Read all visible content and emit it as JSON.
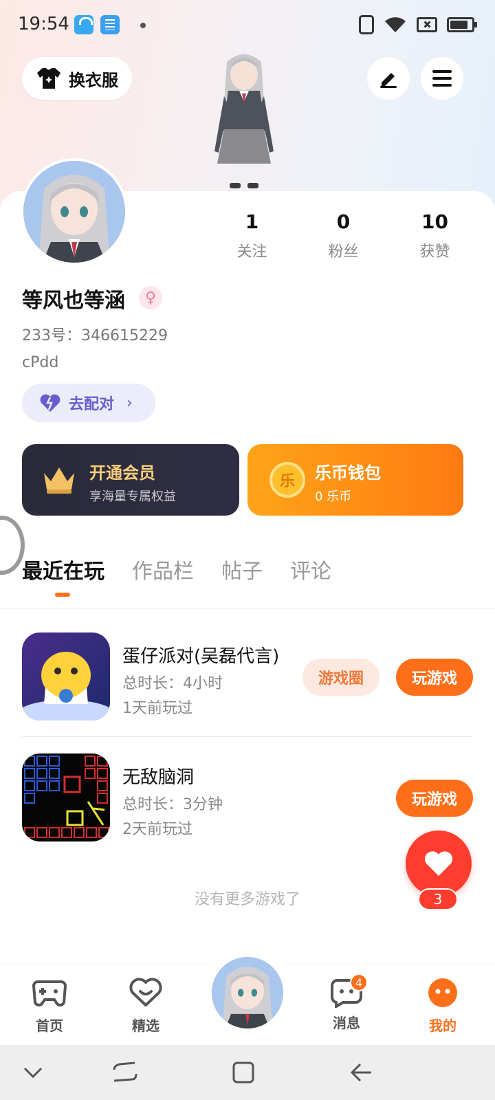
{
  "status_bar": {
    "time": "19:54",
    "battery_level": 0.85
  },
  "header": {
    "dress_label": "换衣服"
  },
  "profile": {
    "username": "等风也等涵",
    "uid": "233号：346615229",
    "signature": "cPdd",
    "match_label": "去配对",
    "stats": [
      {
        "value": "1",
        "label": "关注"
      },
      {
        "value": "0",
        "label": "粉丝"
      },
      {
        "value": "10",
        "label": "获赞"
      }
    ]
  },
  "cards": {
    "vip_title": "开通会员",
    "vip_subtitle": "享海量专属权益",
    "wallet_title": "乐币钱包",
    "wallet_subtitle": "0 乐币",
    "coin_glyph": "乐"
  },
  "tabs": [
    "最近在玩",
    "作品栏",
    "帖子",
    "评论"
  ],
  "games": [
    {
      "name": "蛋仔派对(吴磊代言)",
      "duration": "总时长：4小时",
      "last_played": "1天前玩过",
      "circle_label": "游戏圈",
      "play_label": "玩游戏"
    },
    {
      "name": "无敌脑洞",
      "duration": "总时长：3分钟",
      "last_played": "2天前玩过",
      "play_label": "玩游戏"
    }
  ],
  "no_more": "没有更多游戏了",
  "like_count": "3",
  "bottom_nav": {
    "items": [
      {
        "label": "首页",
        "icon": "gamepad-icon"
      },
      {
        "label": "精选",
        "icon": "heart-chat-icon"
      },
      {
        "label": "消息",
        "icon": "message-icon",
        "badge": "4"
      },
      {
        "label": "我的",
        "icon": "me-icon"
      }
    ]
  },
  "colors": {
    "accent": "#ff6f1a",
    "like": "#ff3d2e",
    "match": "#6d5ccf",
    "vip_gold": "#f6cf79"
  }
}
